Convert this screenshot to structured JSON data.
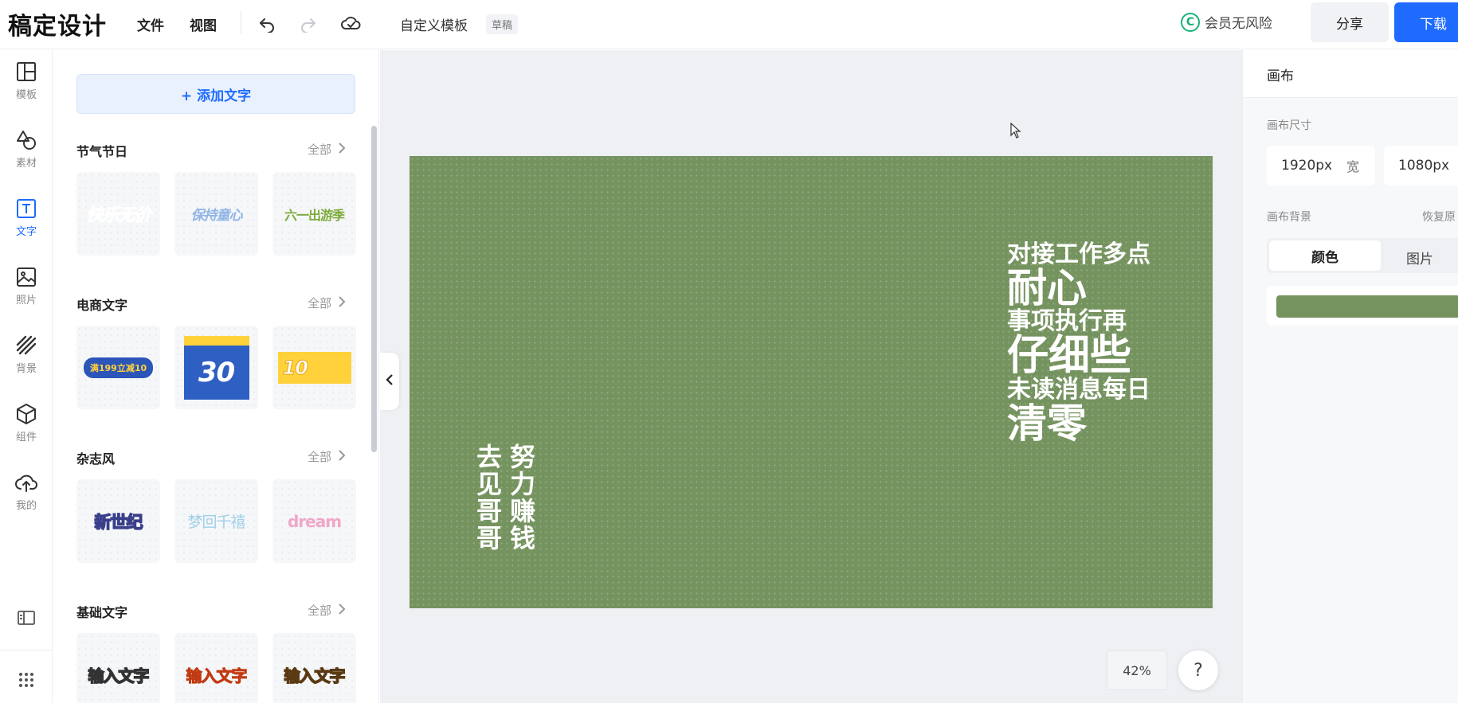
{
  "topbar": {
    "logo": "稿定设计",
    "menu_file": "文件",
    "menu_view": "视图",
    "template_name": "自定义模板",
    "draft_badge": "草稿",
    "member_text": "会员无风险",
    "member_mark": "C",
    "share_label": "分享",
    "download_label": "下载"
  },
  "leftnav": {
    "items": [
      {
        "label": "模板",
        "icon": "layout-icon"
      },
      {
        "label": "素材",
        "icon": "shapes-icon"
      },
      {
        "label": "文字",
        "icon": "text-icon"
      },
      {
        "label": "照片",
        "icon": "image-icon"
      },
      {
        "label": "背景",
        "icon": "stripes-icon"
      },
      {
        "label": "组件",
        "icon": "cube-icon"
      },
      {
        "label": "我的",
        "icon": "cloud-upload-icon"
      }
    ],
    "active": "文字"
  },
  "panel": {
    "add_text_label": "+ 添加文字",
    "more_label": "全部",
    "sections": [
      {
        "title": "节气节日",
        "thumbs": [
          "快乐无价",
          "保持童心",
          "六一出游季"
        ]
      },
      {
        "title": "电商文字",
        "thumbs": [
          "满199立减10",
          "30",
          "10"
        ]
      },
      {
        "title": "杂志风",
        "thumbs": [
          "新世纪",
          "梦回千禧",
          "dream"
        ]
      },
      {
        "title": "基础文字",
        "thumbs": [
          "输入文字",
          "输入文字",
          "输入文字"
        ]
      }
    ]
  },
  "canvas": {
    "bg_color": "#75935f",
    "right_lines": [
      "对接工作多点",
      "耐心",
      "事项执行再",
      "仔细些",
      "未读消息每日",
      "清零"
    ],
    "left_col1": [
      "去",
      "见",
      "哥",
      "哥"
    ],
    "left_col2": [
      "努",
      "力",
      "赚",
      "钱"
    ]
  },
  "workspace": {
    "zoom": "42%",
    "help": "?"
  },
  "rpanel": {
    "title": "画布",
    "size_label": "画布尺寸",
    "width_value": "1920px",
    "width_unit": "宽",
    "height_value": "1080px",
    "bg_label": "画布背景",
    "restore_label": "恢复原",
    "tab_color": "颜色",
    "tab_image": "图片"
  }
}
